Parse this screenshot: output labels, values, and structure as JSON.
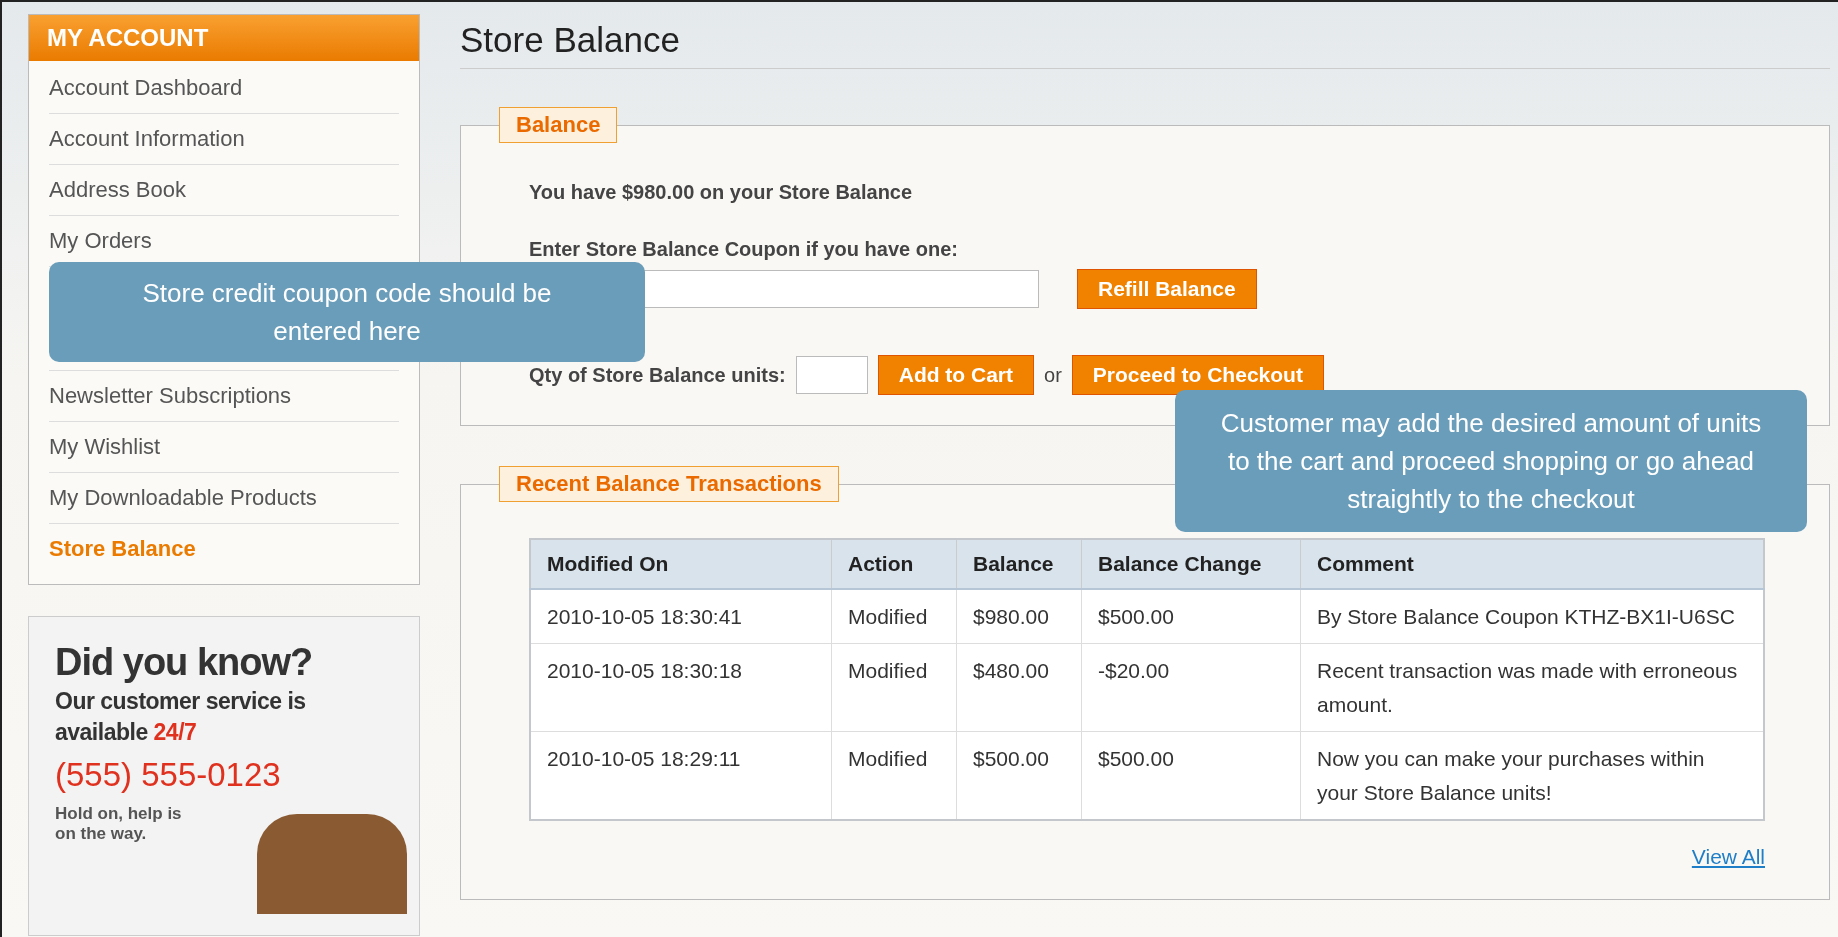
{
  "sidebar": {
    "title": "MY ACCOUNT",
    "items": [
      {
        "label": "Account Dashboard",
        "selected": false
      },
      {
        "label": "Account Information",
        "selected": false
      },
      {
        "label": "Address Book",
        "selected": false
      },
      {
        "label": "My Orders",
        "selected": false
      },
      {
        "label": "Newsletter Subscriptions",
        "selected": false
      },
      {
        "label": "My Wishlist",
        "selected": false
      },
      {
        "label": "My Downloadable Products",
        "selected": false
      },
      {
        "label": "Store Balance",
        "selected": true
      }
    ]
  },
  "promo": {
    "heading": "Did you know?",
    "line_1": "Our customer service is",
    "line_2": "available",
    "highlight": "24/7",
    "phone": "(555) 555-0123",
    "note_1": "Hold on, help is",
    "note_2": "on the way."
  },
  "page_title": "Store Balance",
  "balance": {
    "legend": "Balance",
    "summary": "You have $980.00 on your Store Balance",
    "coupon_label": "Enter Store Balance Coupon if you have one:",
    "refill_button": "Refill Balance",
    "qty_label": "Qty of Store Balance units:",
    "add_button": "Add to Cart",
    "or": "or",
    "checkout_button": "Proceed to Checkout"
  },
  "transactions": {
    "legend": "Recent Balance Transactions",
    "columns": [
      "Modified On",
      "Action",
      "Balance",
      "Balance Change",
      "Comment"
    ],
    "rows": [
      [
        "2010-10-05 18:30:41",
        "Modified",
        "$980.00",
        "$500.00",
        "By Store Balance Coupon KTHZ-BX1I-U6SC"
      ],
      [
        "2010-10-05 18:30:18",
        "Modified",
        "$480.00",
        "-$20.00",
        "Recent transaction was made with erroneous amount."
      ],
      [
        "2010-10-05 18:29:11",
        "Modified",
        "$500.00",
        "$500.00",
        "Now you can make your purchases within your Store Balance units!"
      ]
    ],
    "view_all": "View All"
  },
  "callouts": [
    {
      "text": "Store credit coupon code should be entered here"
    },
    {
      "text": "Customer may add the desired amount of units to the cart and proceed shopping or go ahead straightly to the checkout"
    }
  ]
}
